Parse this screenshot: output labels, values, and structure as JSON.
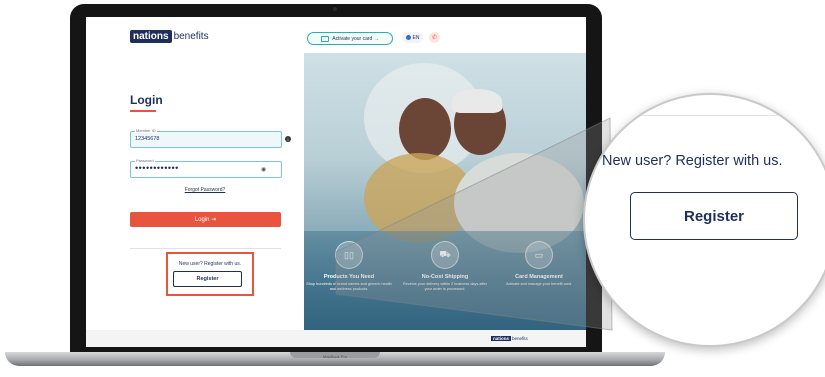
{
  "header": {
    "logo_box": "nations",
    "logo_text": "benefits",
    "activate_label": "Activate your card →",
    "lang_label": "EN"
  },
  "login": {
    "title": "Login",
    "member_id_label": "Member ID",
    "member_id_value": "12345678",
    "password_label": "Password",
    "password_value": "••••••••••••",
    "forgot_label": "Forgot Password?",
    "login_button": "Login ⇥"
  },
  "register": {
    "prompt": "New user? Register with us.",
    "button": "Register"
  },
  "features": [
    {
      "title": "Products You Need",
      "desc": "Shop hundreds of brand names and generic health and wellness products."
    },
    {
      "title": "No-Cost Shipping",
      "desc": "Receive your delivery within 2 business days after your order is processed."
    },
    {
      "title": "Card Management",
      "desc": "Activate and manage your benefit card."
    }
  ],
  "footer_logo": {
    "box": "nations",
    "text": "benefits"
  },
  "laptop_label": "MacBook Pro",
  "zoom": {
    "prompt": "New user? Register with us.",
    "button": "Register"
  },
  "colors": {
    "brand_navy": "#1e2f5c",
    "accent_red": "#e8543e",
    "teal": "#2bb0a7"
  },
  "icons": [
    "info-icon",
    "eye-icon",
    "globe-icon",
    "phone-icon",
    "card-icon",
    "products-icon",
    "truck-icon",
    "card-management-icon"
  ]
}
